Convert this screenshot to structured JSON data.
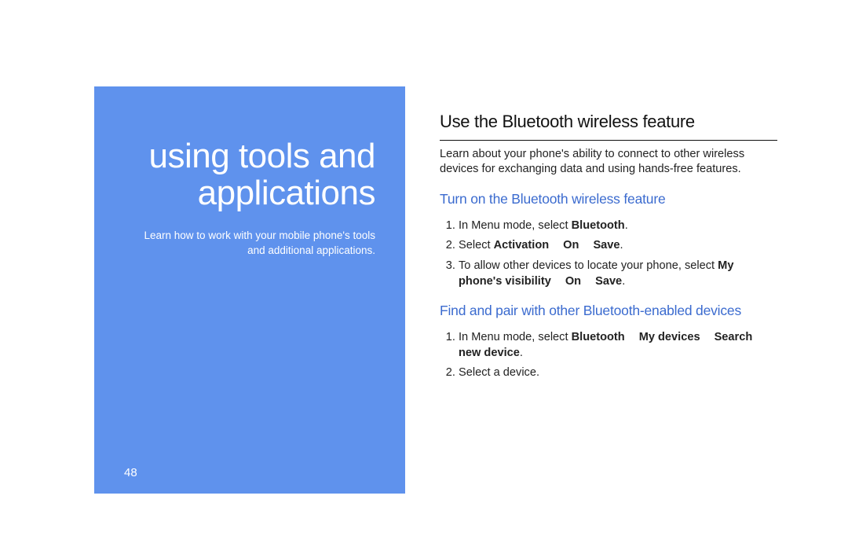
{
  "left": {
    "title_l1": "using tools and",
    "title_l2": "applications",
    "subtitle_l1": "Learn how to work with your mobile phone's tools",
    "subtitle_l2": "and additional applications.",
    "page_number": "48"
  },
  "right": {
    "heading": "Use the Bluetooth wireless feature",
    "intro": "Learn about your phone's ability to connect to other wireless devices for exchanging data and using hands-free features.",
    "section1": {
      "title": "Turn on the Bluetooth wireless feature",
      "step1_a": "In Menu mode, select ",
      "step1_b": "Bluetooth",
      "step1_c": ".",
      "step2_a": "Select ",
      "step2_b": "Activation",
      "step2_c": "On",
      "step2_d": "Save",
      "step2_e": ".",
      "step3_a": "To allow other devices to locate your phone, select ",
      "step3_b": "My phone's visibility",
      "step3_c": "On",
      "step3_d": "Save",
      "step3_e": "."
    },
    "section2": {
      "title": "Find and pair with other Bluetooth-enabled devices",
      "step1_a": "In Menu mode, select ",
      "step1_b": "Bluetooth",
      "step1_c": "My devices",
      "step1_d": "Search new device",
      "step1_e": ".",
      "step2": "Select a device."
    }
  }
}
